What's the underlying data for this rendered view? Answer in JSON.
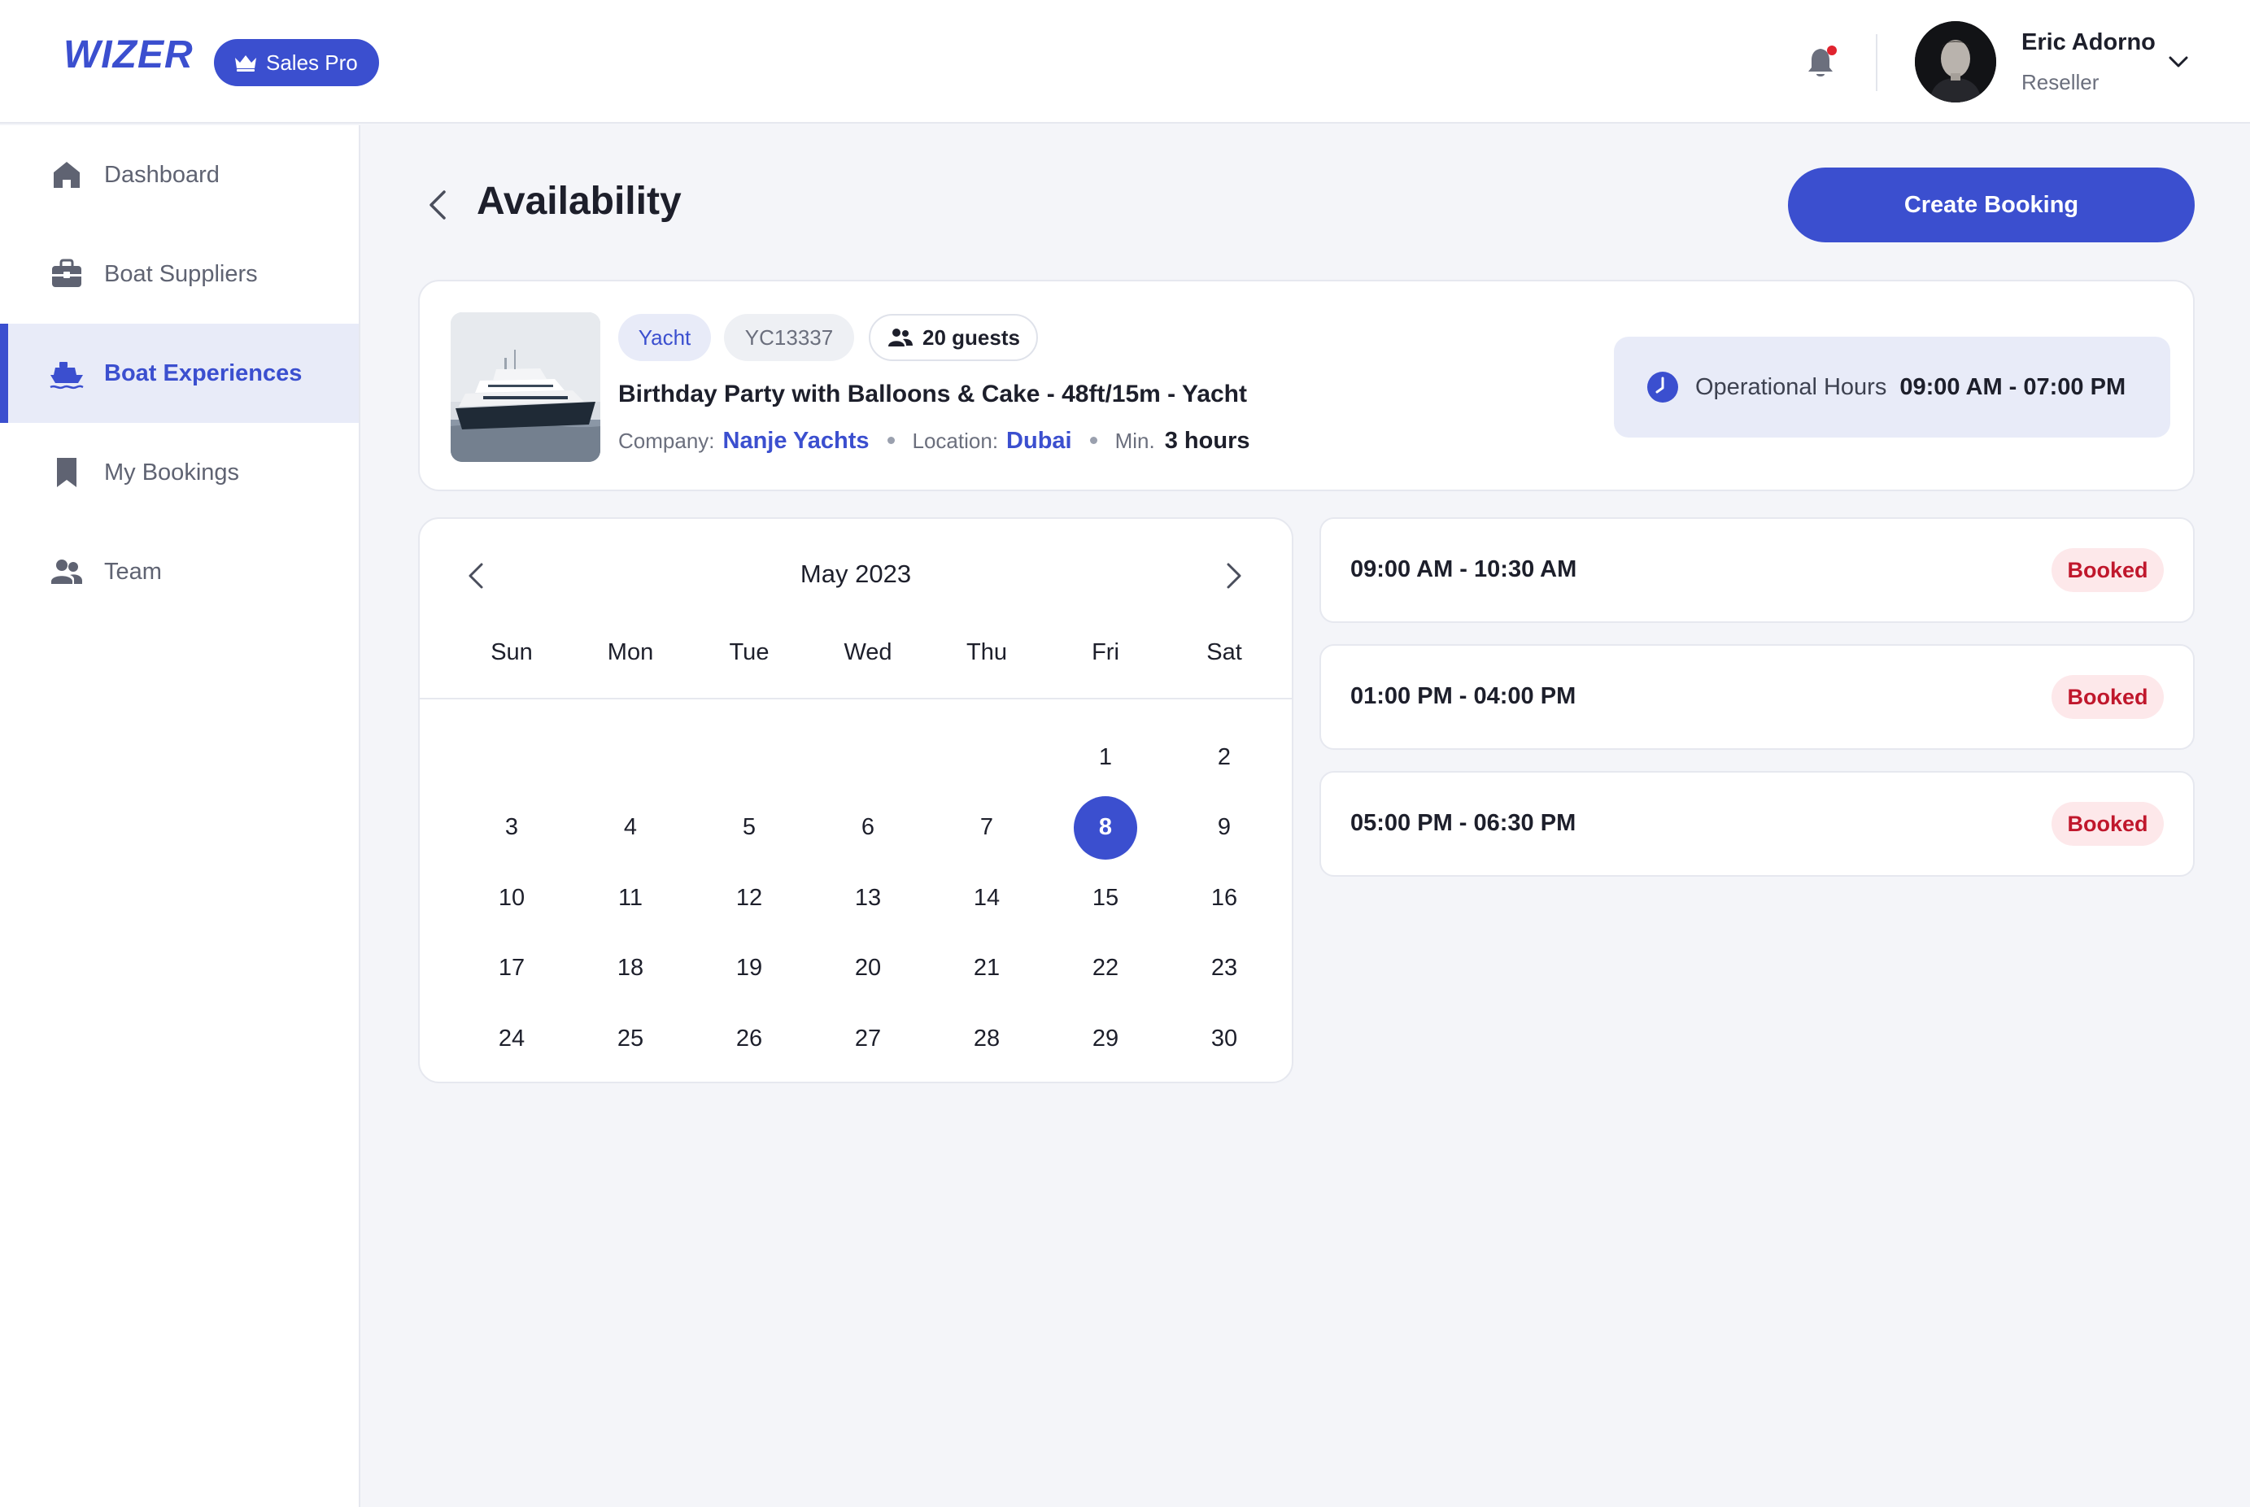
{
  "header": {
    "logo_text": "WIZER",
    "plan_label": "Sales Pro",
    "user": {
      "name": "Eric Adorno",
      "role": "Reseller"
    },
    "notification_dot_color": "#e0242f"
  },
  "sidebar": {
    "items": [
      {
        "label": "Dashboard",
        "icon": "home-icon",
        "active": false
      },
      {
        "label": "Boat Suppliers",
        "icon": "briefcase-icon",
        "active": false
      },
      {
        "label": "Boat Experiences",
        "icon": "ship-icon",
        "active": true
      },
      {
        "label": "My Bookings",
        "icon": "bookmark-icon",
        "active": false
      },
      {
        "label": "Team",
        "icon": "users-icon",
        "active": false
      }
    ]
  },
  "page": {
    "title": "Availability",
    "create_button_label": "Create Booking"
  },
  "experience": {
    "type": "Yacht",
    "code": "YC13337",
    "guests": "20 guests",
    "title": "Birthday Party with Balloons & Cake - 48ft/15m - Yacht",
    "company_label": "Company:",
    "company": "Nanje Yachts",
    "location_label": "Location:",
    "location": "Dubai",
    "min_label": "Min.",
    "min_duration": "3 hours",
    "operational_hours_label": "Operational Hours",
    "operational_hours": "09:00 AM - 07:00 PM"
  },
  "calendar": {
    "month_label": "May 2023",
    "weekdays": [
      "Sun",
      "Mon",
      "Tue",
      "Wed",
      "Thu",
      "Fri",
      "Sat"
    ],
    "leading_blanks": 5,
    "days_shown": 30,
    "selected_day": 8
  },
  "slots": [
    {
      "time": "09:00 AM - 10:30 AM",
      "status": "Booked"
    },
    {
      "time": "01:00 PM - 04:00 PM",
      "status": "Booked"
    },
    {
      "time": "05:00 PM - 06:30 PM",
      "status": "Booked"
    }
  ],
  "colors": {
    "accent": "#3b4fcf",
    "accent_soft": "#e8ebf8",
    "booked_bg": "#fde8ea",
    "booked_text": "#c0172c"
  }
}
